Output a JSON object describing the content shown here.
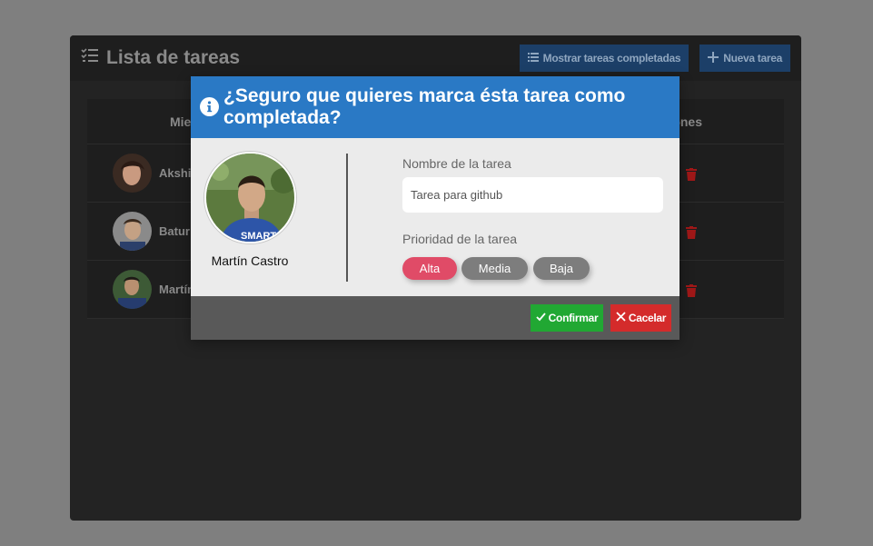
{
  "app": {
    "title": "Lista de tareas",
    "show_completed_label": "Mostrar tareas completadas",
    "new_task_label": "Nueva tarea"
  },
  "table": {
    "col_members": "Mier",
    "col_actions": "ones",
    "rows": [
      {
        "name": "Akshit"
      },
      {
        "name": "Batur"
      },
      {
        "name": "Martín"
      }
    ]
  },
  "modal": {
    "title": "¿Seguro que quieres marca ésta tarea como completada?",
    "user_name": "Martín Castro",
    "task_name_label": "Nombre de la tarea",
    "task_name_value": "Tarea para github",
    "priority_label": "Prioridad de la tarea",
    "priorities": [
      "Alta",
      "Media",
      "Baja"
    ],
    "selected_priority": "Alta",
    "confirm_label": "Confirmar",
    "cancel_label": "Cacelar"
  },
  "colors": {
    "accent": "#2a79c5",
    "confirm": "#21a833",
    "cancel": "#d42b2b",
    "priority_selected": "#e04b67",
    "priority_unselected": "#7d7d7d"
  }
}
